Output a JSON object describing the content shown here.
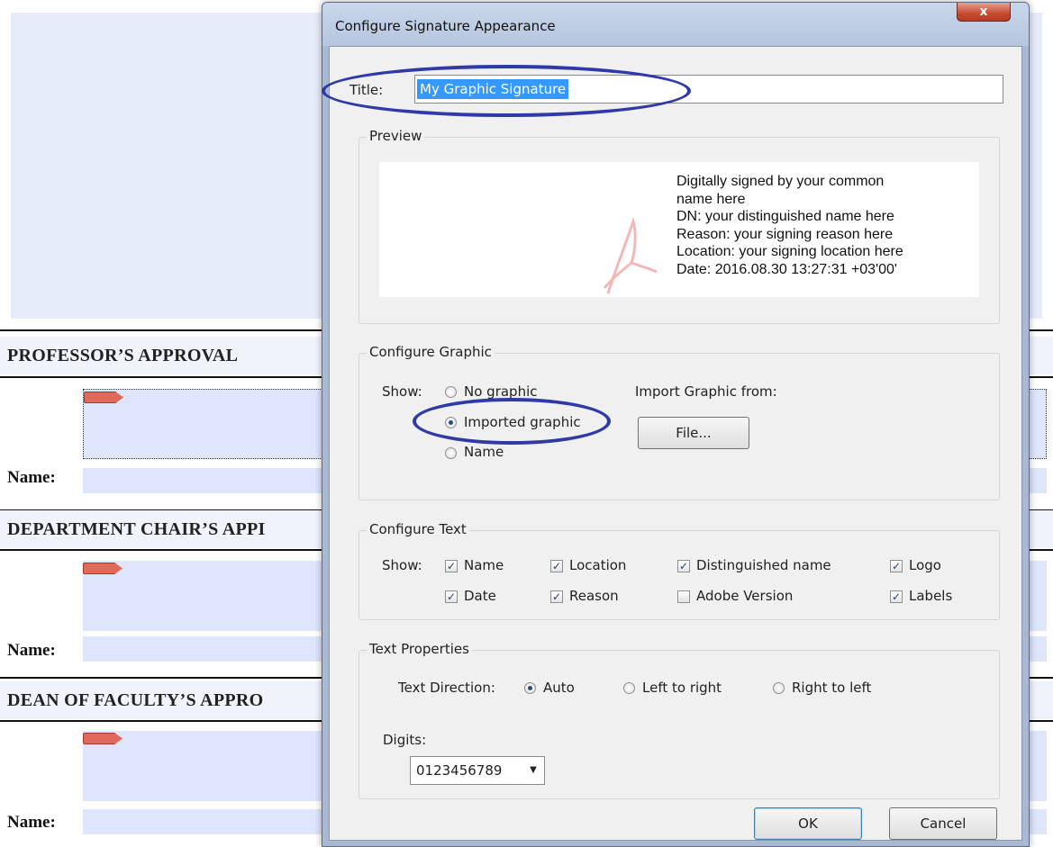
{
  "document": {
    "sections": [
      {
        "heading": "PROFESSOR’S APPROVAL",
        "name_label": "Name:"
      },
      {
        "heading": "DEPARTMENT CHAIR’S APPI",
        "name_label": "Name:"
      },
      {
        "heading": "DEAN OF FACULTY’S APPRO",
        "name_label": "Name:"
      }
    ]
  },
  "dialog": {
    "title": "Configure Signature Appearance",
    "close_label": "x",
    "title_field": {
      "label": "Title:",
      "value": "My Graphic Signature"
    },
    "preview": {
      "group_label": "Preview",
      "lines": [
        "Digitally signed by your common",
        "name here",
        "DN: your distinguished name here",
        "Reason: your signing reason here",
        "Location: your signing location here",
        "Date: 2016.08.30 13:27:31 +03'00'"
      ]
    },
    "configure_graphic": {
      "group_label": "Configure Graphic",
      "show_label": "Show:",
      "options": [
        {
          "label": "No graphic",
          "selected": false
        },
        {
          "label": "Imported graphic",
          "selected": true
        },
        {
          "label": "Name",
          "selected": false
        }
      ],
      "import_label": "Import Graphic from:",
      "file_button": "File..."
    },
    "configure_text": {
      "group_label": "Configure Text",
      "show_label": "Show:",
      "checkboxes": [
        {
          "label": "Name",
          "checked": true
        },
        {
          "label": "Location",
          "checked": true
        },
        {
          "label": "Distinguished name",
          "checked": true
        },
        {
          "label": "Logo",
          "checked": true
        },
        {
          "label": "Date",
          "checked": true
        },
        {
          "label": "Reason",
          "checked": true
        },
        {
          "label": "Adobe Version",
          "checked": false
        },
        {
          "label": "Labels",
          "checked": true
        }
      ]
    },
    "text_properties": {
      "group_label": "Text Properties",
      "direction_label": "Text Direction:",
      "directions": [
        {
          "label": "Auto",
          "selected": true
        },
        {
          "label": "Left to right",
          "selected": false
        },
        {
          "label": "Right to left",
          "selected": false
        }
      ],
      "digits_label": "Digits:",
      "digits_value": "0123456789"
    },
    "ok_label": "OK",
    "cancel_label": "Cancel"
  },
  "colors": {
    "annotation": "#2f39a8",
    "selection": "#3399ff",
    "close_button": "#c74a32",
    "doc_field": "#dfe5fb"
  }
}
